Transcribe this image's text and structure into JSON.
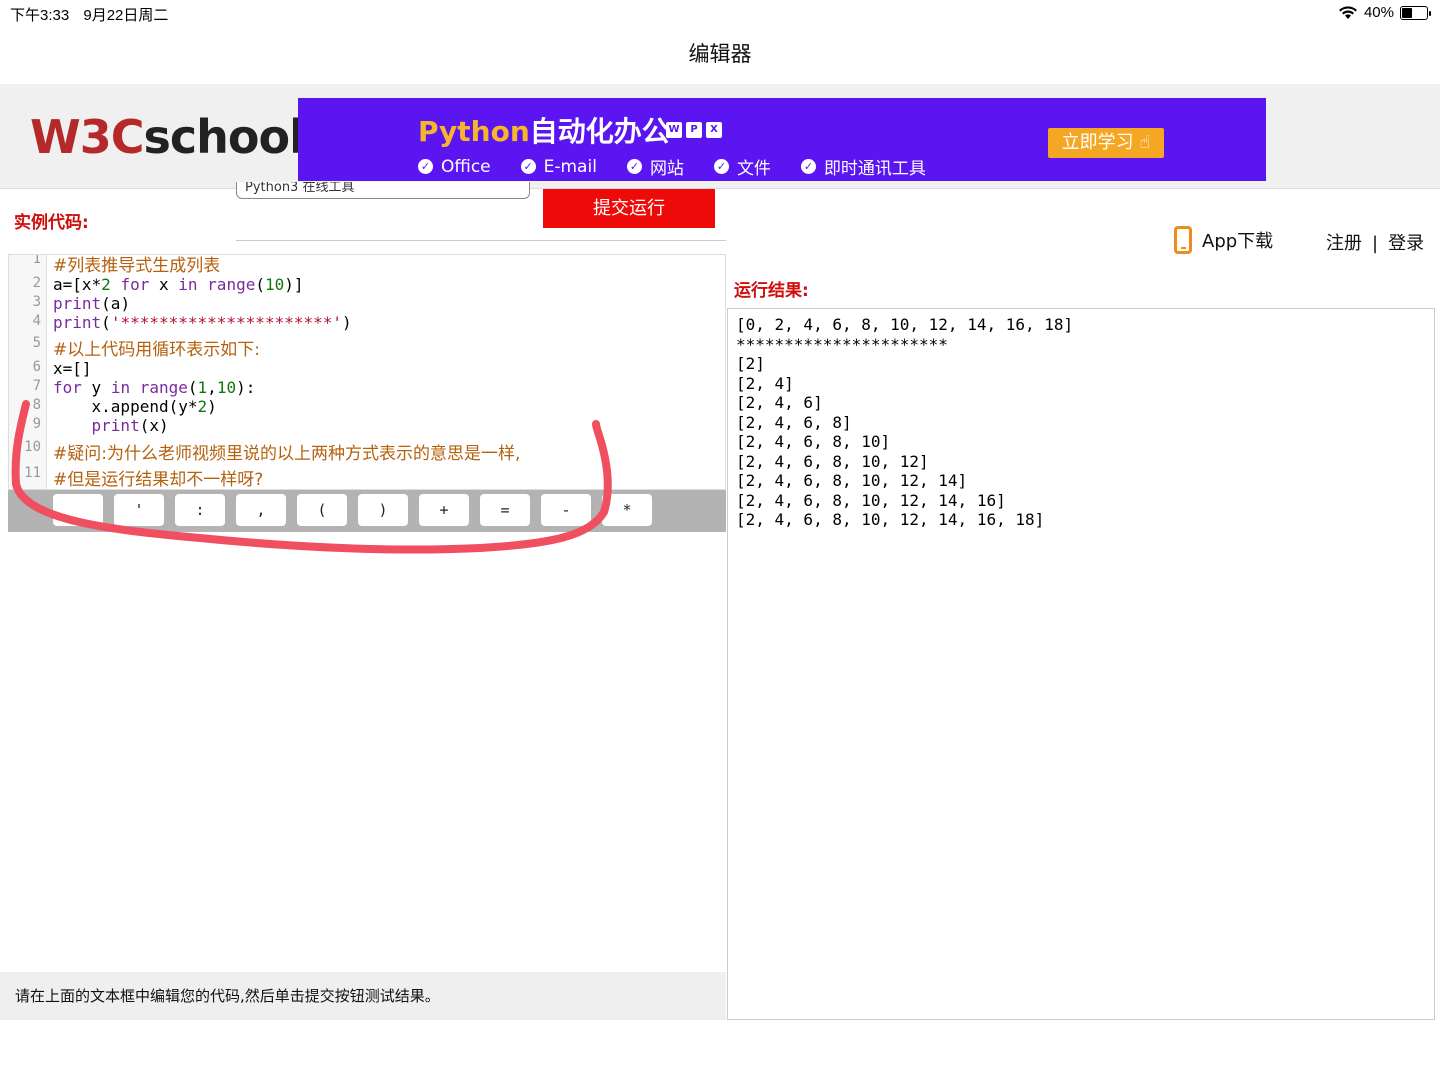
{
  "status_bar": {
    "time": "下午3:33",
    "date": "9月22日周二",
    "battery": "40%",
    "battery_level": 0.4,
    "wifi_icon": "wifi-icon",
    "battery_icon": "battery-icon"
  },
  "nav": {
    "title": "编辑器"
  },
  "header": {
    "logo_red": "W3C",
    "logo_dark": "school",
    "ad": {
      "title_highlight": "Python",
      "title_rest": "自动化办公",
      "icons": [
        "W",
        "P",
        "X"
      ],
      "features": [
        "Office",
        "E-mail",
        "网站",
        "文件",
        "即时通讯工具"
      ],
      "cta": "立即学习",
      "bg_color": "#5b15f0",
      "cta_color": "#f5a623"
    }
  },
  "editor": {
    "section_label": "实例代码:",
    "title_input_value": "Python3 在线工具",
    "submit_label": "提交运行",
    "line_numbers": [
      "1",
      "2",
      "3",
      "4",
      "5",
      "6",
      "7",
      "8",
      "9",
      "10",
      "11"
    ],
    "lines": [
      [
        {
          "t": "#列表推导式生成列表",
          "c": "cm"
        }
      ],
      [
        {
          "t": "a=[x*",
          "c": ""
        },
        {
          "t": "2",
          "c": "num"
        },
        {
          "t": " ",
          "c": ""
        },
        {
          "t": "for",
          "c": "kw"
        },
        {
          "t": " x ",
          "c": ""
        },
        {
          "t": "in",
          "c": "kw"
        },
        {
          "t": " ",
          "c": ""
        },
        {
          "t": "range",
          "c": "kw"
        },
        {
          "t": "(",
          "c": ""
        },
        {
          "t": "10",
          "c": "num"
        },
        {
          "t": ")]",
          "c": ""
        }
      ],
      [
        {
          "t": "print",
          "c": "kw"
        },
        {
          "t": "(a)",
          "c": ""
        }
      ],
      [
        {
          "t": "print",
          "c": "kw"
        },
        {
          "t": "(",
          "c": ""
        },
        {
          "t": "'**********************'",
          "c": "str"
        },
        {
          "t": ")",
          "c": ""
        }
      ],
      [
        {
          "t": "#以上代码用循环表示如下:",
          "c": "cm"
        }
      ],
      [
        {
          "t": "x=[]",
          "c": ""
        }
      ],
      [
        {
          "t": "for",
          "c": "kw"
        },
        {
          "t": " y ",
          "c": ""
        },
        {
          "t": "in",
          "c": "kw"
        },
        {
          "t": " ",
          "c": ""
        },
        {
          "t": "range",
          "c": "kw"
        },
        {
          "t": "(",
          "c": ""
        },
        {
          "t": "1",
          "c": "num"
        },
        {
          "t": ",",
          "c": ""
        },
        {
          "t": "10",
          "c": "num"
        },
        {
          "t": "):",
          "c": ""
        }
      ],
      [
        {
          "t": "    x.append(y*",
          "c": ""
        },
        {
          "t": "2",
          "c": "num"
        },
        {
          "t": ")",
          "c": ""
        }
      ],
      [
        {
          "t": "    ",
          "c": ""
        },
        {
          "t": "print",
          "c": "kw"
        },
        {
          "t": "(x)",
          "c": ""
        }
      ],
      [
        {
          "t": "#疑问:为什么老师视频里说的以上两种方式表示的意思是一样,",
          "c": "cm"
        }
      ],
      [
        {
          "t": "#但是运行结果却不一样呀?",
          "c": "cm"
        }
      ]
    ],
    "symbol_keys": [
      "",
      "'",
      ":",
      ",",
      "(",
      ")",
      "+",
      "=",
      "-",
      "*"
    ],
    "footer_text": "请在上面的文本框中编辑您的代码,然后单击提交按钮测试结果。"
  },
  "right": {
    "app_download": "App下载",
    "register": "注册",
    "separator": "|",
    "login": "登录",
    "result_label": "运行结果:",
    "output_lines": [
      "[0, 2, 4, 6, 8, 10, 12, 14, 16, 18]",
      "**********************",
      "[2]",
      "[2, 4]",
      "[2, 4, 6]",
      "[2, 4, 6, 8]",
      "[2, 4, 6, 8, 10]",
      "[2, 4, 6, 8, 10, 12]",
      "[2, 4, 6, 8, 10, 12, 14]",
      "[2, 4, 6, 8, 10, 12, 14, 16]",
      "[2, 4, 6, 8, 10, 12, 14, 16, 18]"
    ]
  },
  "colors": {
    "brand_red": "#d10e0e",
    "submit_red": "#ef0a0a",
    "annotation_red": "#ef4f5f"
  }
}
